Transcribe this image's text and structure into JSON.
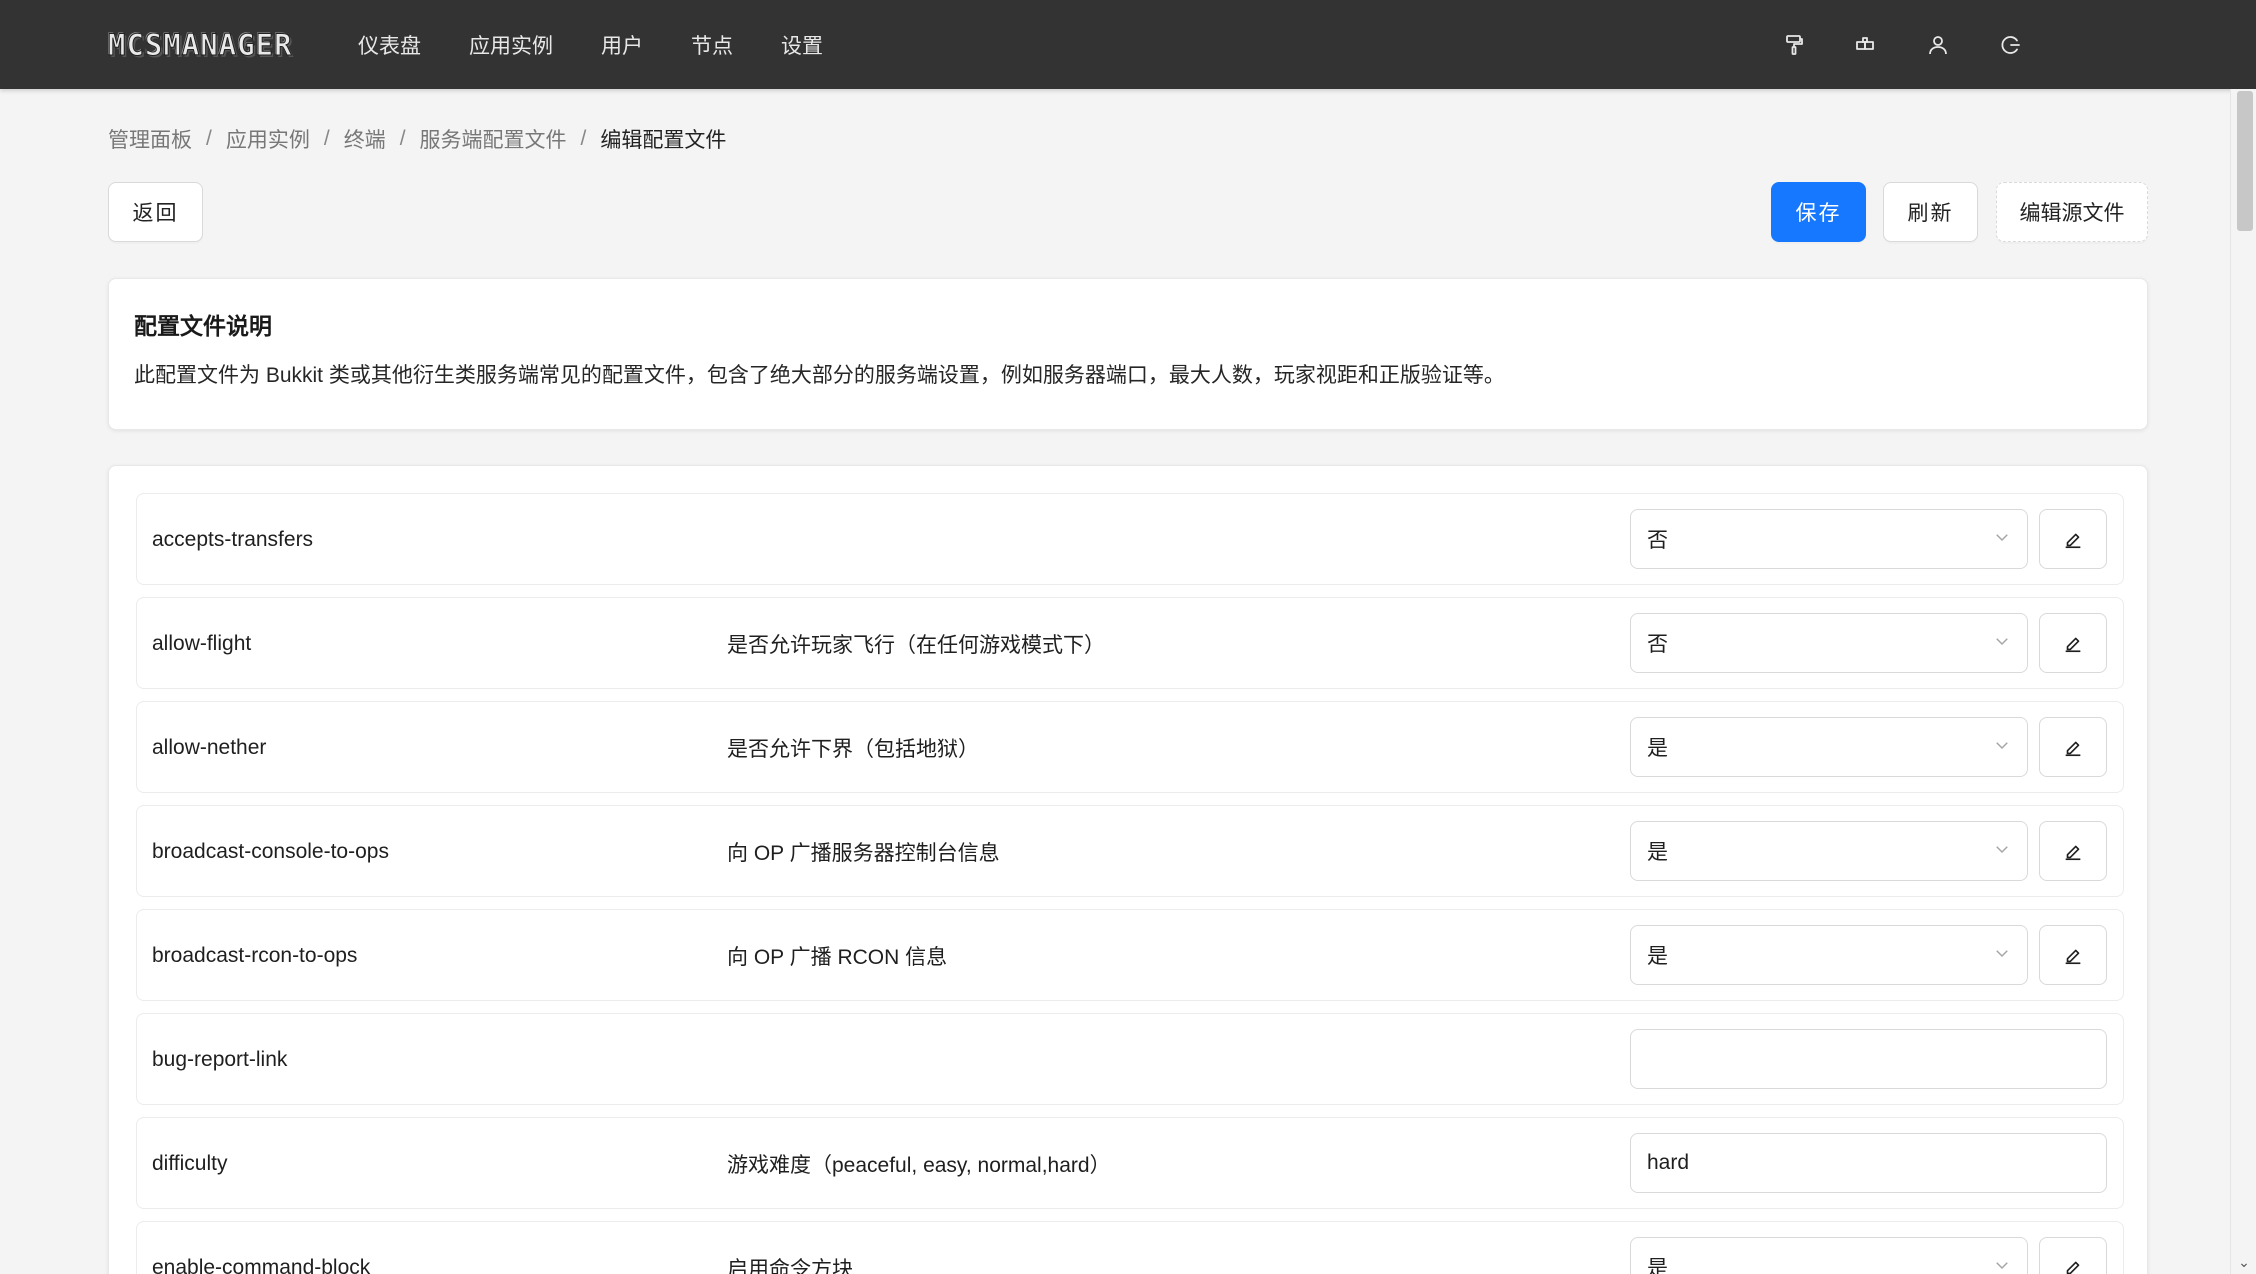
{
  "app": {
    "logo_text": "MCSMANAGER"
  },
  "nav": {
    "items": [
      "仪表盘",
      "应用实例",
      "用户",
      "节点",
      "设置"
    ],
    "icons": [
      "paint-roller-icon",
      "puzzle-icon",
      "user-icon",
      "logout-icon"
    ]
  },
  "breadcrumb": [
    "管理面板",
    "应用实例",
    "终端",
    "服务端配置文件",
    "编辑配置文件"
  ],
  "breadcrumb_separator": "/",
  "toolbar": {
    "back_label": "返回",
    "save_label": "保存",
    "refresh_label": "刷新",
    "edit_source_label": "编辑源文件"
  },
  "description": {
    "title": "配置文件说明",
    "text": "此配置文件为 Bukkit 类或其他衍生类服务端常见的配置文件，包含了绝大部分的服务端设置，例如服务器端口，最大人数，玩家视距和正版验证等。"
  },
  "config_rows": [
    {
      "key": "accepts-transfers",
      "desc": "",
      "type": "select",
      "value": "否"
    },
    {
      "key": "allow-flight",
      "desc": "是否允许玩家飞行（在任何游戏模式下）",
      "type": "select",
      "value": "否"
    },
    {
      "key": "allow-nether",
      "desc": "是否允许下界（包括地狱）",
      "type": "select",
      "value": "是"
    },
    {
      "key": "broadcast-console-to-ops",
      "desc": "向 OP 广播服务器控制台信息",
      "type": "select",
      "value": "是"
    },
    {
      "key": "broadcast-rcon-to-ops",
      "desc": "向 OP 广播 RCON 信息",
      "type": "select",
      "value": "是"
    },
    {
      "key": "bug-report-link",
      "desc": "",
      "type": "input",
      "value": ""
    },
    {
      "key": "difficulty",
      "desc": "游戏难度（peaceful, easy, normal,hard）",
      "type": "input",
      "value": "hard"
    },
    {
      "key": "enable-command-block",
      "desc": "启用命令方块",
      "type": "select",
      "value": "是"
    }
  ],
  "colors": {
    "topbar": "#333333",
    "primary": "#1677ff",
    "background": "#f4f4f4"
  }
}
